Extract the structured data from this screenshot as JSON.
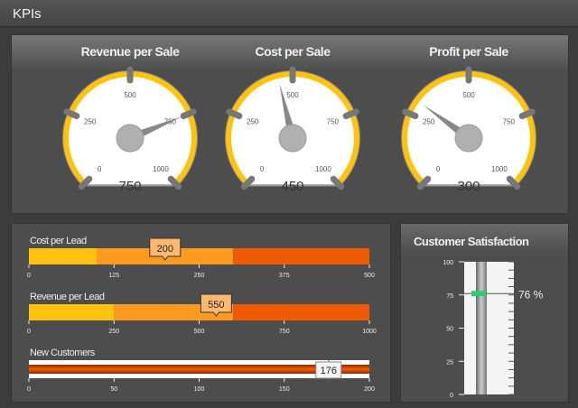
{
  "window": {
    "title": "KPIs"
  },
  "gauges": [
    {
      "title": "Revenue per Sale",
      "value": 750,
      "value_label": "750",
      "min": 0,
      "max": 1000,
      "ticks": [
        "0",
        "250",
        "500",
        "750",
        "1000"
      ]
    },
    {
      "title": "Cost per Sale",
      "value": 450,
      "value_label": "450",
      "min": 0,
      "max": 1000,
      "ticks": [
        "0",
        "250",
        "500",
        "750",
        "1000"
      ]
    },
    {
      "title": "Profit per Sale",
      "value": 300,
      "value_label": "300",
      "min": 0,
      "max": 1000,
      "ticks": [
        "0",
        "250",
        "500",
        "750",
        "1000"
      ]
    }
  ],
  "bullets": [
    {
      "title": "Cost per Lead",
      "value": 200,
      "value_label": "200",
      "max": 500,
      "bands": [
        100,
        300,
        500
      ],
      "ticks": [
        "0",
        "125",
        "250",
        "375",
        "500"
      ]
    },
    {
      "title": "Revenue per Lead",
      "value": 550,
      "value_label": "550",
      "max": 1000,
      "bands": [
        250,
        600,
        1000
      ],
      "ticks": [
        "0",
        "250",
        "500",
        "750",
        "1000"
      ]
    },
    {
      "title": "New Customers",
      "value": 176,
      "value_label": "176",
      "max": 200,
      "ticks": [
        "0",
        "50",
        "100",
        "150",
        "200"
      ]
    }
  ],
  "satisfaction": {
    "title": "Customer Satisfaction",
    "value": 76,
    "value_label": "76 %",
    "ticks": [
      "0",
      "25",
      "50",
      "75",
      "100"
    ]
  },
  "colors": {
    "yellow": "#ffc20e",
    "orange": "#ff9a20",
    "red": "#f05a00",
    "marker": "#2ecc71",
    "callout": "#ffb870"
  }
}
